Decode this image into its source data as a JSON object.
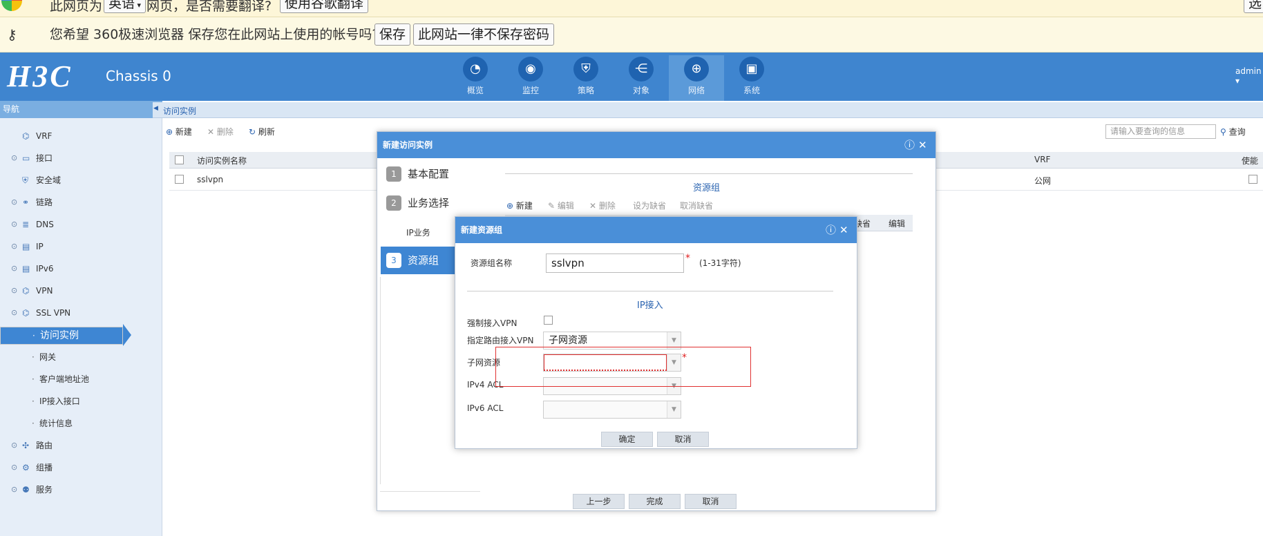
{
  "browser": {
    "translate_bar": {
      "prefix": "此网页为",
      "language": "英语",
      "suffix": "网页，是否需要翻译?",
      "translate_button": "使用谷歌翻译",
      "right_button": "选"
    },
    "password_bar": {
      "message": "您希望 360极速浏览器 保存您在此网站上使用的帐号吗?",
      "save_button": "保存",
      "never_button": "此网站一律不保存密码"
    }
  },
  "header": {
    "logo": "H3C",
    "device": "Chassis 0",
    "nav": [
      {
        "label": "概览",
        "icon": "gauge-icon",
        "glyph": "◔"
      },
      {
        "label": "监控",
        "icon": "camera-icon",
        "glyph": "◉"
      },
      {
        "label": "策略",
        "icon": "shield-icon",
        "glyph": "⛨"
      },
      {
        "label": "对象",
        "icon": "share-icon",
        "glyph": "⋲"
      },
      {
        "label": "网络",
        "icon": "globe-icon",
        "glyph": "⊕"
      },
      {
        "label": "系统",
        "icon": "monitor-icon",
        "glyph": "▣"
      }
    ],
    "active_nav": "网络",
    "user": "admin"
  },
  "sidebar": {
    "title": "导航",
    "items": [
      {
        "label": "VRF",
        "expand": "",
        "icon": "⌬"
      },
      {
        "label": "接口",
        "expand": "⊙",
        "icon": "▭"
      },
      {
        "label": "安全域",
        "expand": "",
        "icon": "⛨"
      },
      {
        "label": "链路",
        "expand": "⊙",
        "icon": "⚭"
      },
      {
        "label": "DNS",
        "expand": "⊙",
        "icon": "≣"
      },
      {
        "label": "IP",
        "expand": "⊙",
        "icon": "▤"
      },
      {
        "label": "IPv6",
        "expand": "⊙",
        "icon": "▤"
      },
      {
        "label": "VPN",
        "expand": "⊙",
        "icon": "⌬"
      },
      {
        "label": "SSL VPN",
        "expand": "⊙",
        "icon": "⌬"
      },
      {
        "label": "访问实例",
        "expand": "",
        "icon": "·",
        "child": true,
        "selected": true
      },
      {
        "label": "网关",
        "expand": "",
        "icon": "·",
        "child": true
      },
      {
        "label": "客户端地址池",
        "expand": "",
        "icon": "·",
        "child": true
      },
      {
        "label": "IP接入接口",
        "expand": "",
        "icon": "·",
        "child": true
      },
      {
        "label": "统计信息",
        "expand": "",
        "icon": "·",
        "child": true
      },
      {
        "label": "路由",
        "expand": "⊙",
        "icon": "✣"
      },
      {
        "label": "组播",
        "expand": "⊙",
        "icon": "⚙"
      },
      {
        "label": "服务",
        "expand": "⊙",
        "icon": "⚉"
      }
    ]
  },
  "page": {
    "breadcrumb": "访问实例",
    "toolbar": {
      "new": "新建",
      "delete": "删除",
      "refresh": "刷新",
      "search_placeholder": "请输入要查询的信息",
      "search": "查询"
    },
    "table": {
      "columns": [
        "访问实例名称",
        "VRF",
        "使能"
      ],
      "rows": [
        {
          "name": "sslvpn",
          "vrf": "公网"
        }
      ]
    }
  },
  "dialog_instance": {
    "title": "新建访问实例",
    "steps": [
      {
        "num": "1",
        "label": "基本配置"
      },
      {
        "num": "2",
        "label": "业务选择"
      },
      {
        "num": "3",
        "label": "资源组"
      }
    ],
    "sub_step": "IP业务",
    "section": "资源组",
    "toolbar": {
      "new": "新建",
      "edit": "编辑",
      "delete": "删除",
      "set_default": "设为缺省",
      "cancel_default": "取消缺省"
    },
    "columns": {
      "default_suffix": "缺省",
      "edit": "编辑"
    },
    "buttons": {
      "prev": "上一步",
      "finish": "完成",
      "cancel": "取消"
    }
  },
  "dialog_resource": {
    "title": "新建资源组",
    "name_label": "资源组名称",
    "name_value": "sslvpn",
    "name_hint": "(1-31字符)",
    "section": "IP接入",
    "force_vpn_label": "强制接入VPN",
    "route_label": "指定路由接入VPN",
    "route_value": "子网资源",
    "subnet_label": "子网资源",
    "subnet_value": "",
    "ipv4_label": "IPv4 ACL",
    "ipv6_label": "IPv6 ACL",
    "ok": "确定",
    "cancel": "取消"
  }
}
